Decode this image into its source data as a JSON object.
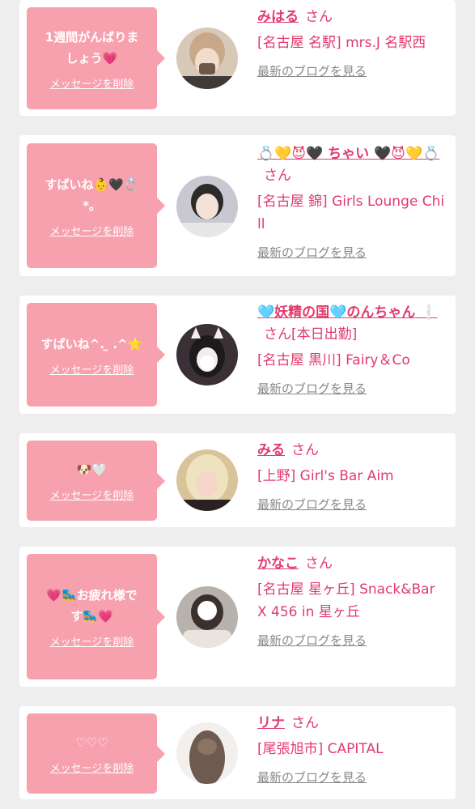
{
  "delete_label": "メッセージを削除",
  "san_label": "さん",
  "blog_label": "最新のブログを見る",
  "entries": [
    {
      "message": "1週間がんばりま\nしょう💗",
      "name": "みはる",
      "name_extra": "",
      "shop": "[名古屋 名駅] mrs.J 名駅西",
      "avatar_bg": "#d8c8b8"
    },
    {
      "message": "すぱいね👶🖤💍\n*。",
      "name": "💍💛😈🖤 ちゃい 🖤😈💛💍",
      "name_extra": "",
      "shop": "[名古屋 錦] Girls Lounge Chill",
      "avatar_bg": "#c8c8d0"
    },
    {
      "message": "すぱいね^. ̫ .^⭐",
      "name": "🩵妖精の国🩵のんちゃん ❕",
      "name_extra": "[本日出勤]",
      "shop": "[名古屋 黒川] Fairy＆Co",
      "avatar_bg": "#3a3036"
    },
    {
      "message": "🐶🤍",
      "name": "みる",
      "name_extra": "",
      "shop": "[上野] Girl's Bar Aim",
      "avatar_bg": "#d9c49a"
    },
    {
      "message": "💗🛼お疲れ様で\nす🛼💗",
      "name": "かなこ",
      "name_extra": "",
      "shop": "[名古屋 星ヶ丘] Snack&Bar X 456 in 星ヶ丘",
      "avatar_bg": "#b8b2ac"
    },
    {
      "message": "♡♡♡",
      "name": "リナ",
      "name_extra": "",
      "shop": "[尾張旭市] CAPITAL",
      "avatar_bg": "#8a7a70"
    }
  ]
}
